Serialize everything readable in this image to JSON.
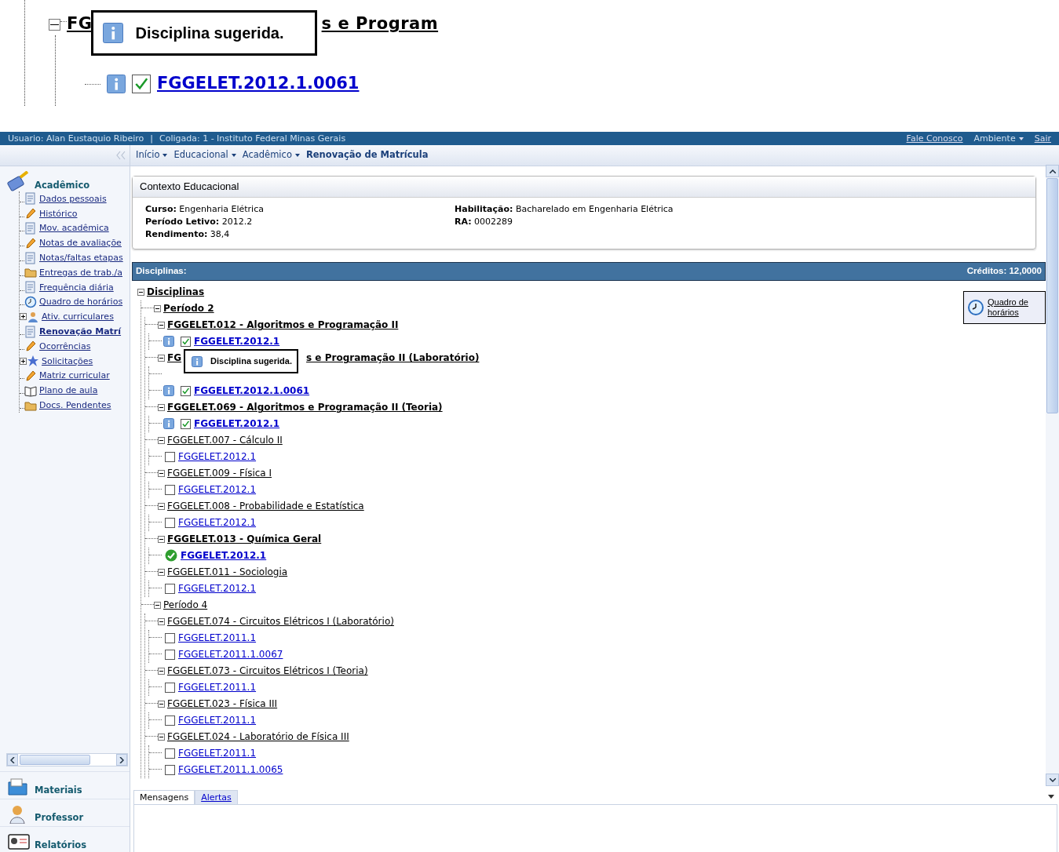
{
  "magnified_view": {
    "course_fragments": [
      "FG",
      "s e Program"
    ],
    "tooltip": "Disciplina sugerida.",
    "class": {
      "info": true,
      "checked": true,
      "code": "FGGELET.2012.1.0061"
    }
  },
  "top_bar": {
    "user": "Usuario: Alan Eustaquio Ribeiro",
    "separator": "|",
    "coligada": "Coligada: 1 - Instituto Federal Minas Gerais",
    "links": [
      {
        "label": "Fale Conosco",
        "kind": "link"
      },
      {
        "label": "Ambiente",
        "kind": "dropdown"
      },
      {
        "label": "Sair",
        "kind": "link"
      }
    ]
  },
  "breadcrumb": [
    {
      "label": "Início",
      "kind": "dropdown"
    },
    {
      "label": "Educacional",
      "kind": "dropdown"
    },
    {
      "label": "Acadêmico",
      "kind": "dropdown"
    },
    {
      "label": "Renovação de Matrícula",
      "kind": "current"
    }
  ],
  "sidebar": {
    "section": "Acadêmico",
    "items": [
      {
        "label": "Dados pessoais",
        "kind": "link",
        "selected": false
      },
      {
        "label": "Histórico",
        "kind": "link",
        "selected": false
      },
      {
        "label": "Mov. acadêmica",
        "kind": "link",
        "selected": false
      },
      {
        "label": "Notas de avaliaçõe",
        "kind": "link",
        "selected": false
      },
      {
        "label": "Notas/faltas etapas",
        "kind": "link",
        "selected": false
      },
      {
        "label": "Entregas de trab./a",
        "kind": "link",
        "selected": false
      },
      {
        "label": "Frequência diária",
        "kind": "link",
        "selected": false
      },
      {
        "label": "Quadro de horários",
        "kind": "link",
        "selected": false
      },
      {
        "label": "Ativ. curriculares",
        "kind": "group",
        "selected": false
      },
      {
        "label": "Renovação Matrí",
        "kind": "link",
        "selected": true
      },
      {
        "label": "Ocorrências",
        "kind": "link",
        "selected": false
      },
      {
        "label": "Solicitações",
        "kind": "group",
        "selected": false
      },
      {
        "label": "Matriz curricular",
        "kind": "link",
        "selected": false
      },
      {
        "label": "Plano de aula",
        "kind": "link",
        "selected": false
      },
      {
        "label": "Docs. Pendentes",
        "kind": "link",
        "selected": false
      }
    ],
    "sections": [
      "Materiais",
      "Professor",
      "Relatórios"
    ]
  },
  "context": {
    "title": "Contexto Educacional",
    "left": [
      {
        "label": "Curso:",
        "value": "Engenharia Elétrica"
      },
      {
        "label": "Período Letivo:",
        "value": "2012.2"
      },
      {
        "label": "Rendimento:",
        "value": "38,4"
      }
    ],
    "right": [
      {
        "label": "Habilitação:",
        "value": "Bacharelado em Engenharia Elétrica"
      },
      {
        "label": "RA:",
        "value": "0002289"
      }
    ]
  },
  "disciplinas_header": {
    "title": "Disciplinas:",
    "credits": "Créditos: 12,0000"
  },
  "schedule_button": "Quadro de horários",
  "tree": {
    "kind": "root",
    "label": "Disciplinas",
    "expanded": true,
    "children": [
      {
        "kind": "period",
        "label": "Período 2",
        "enrolled": true,
        "expanded": true,
        "children": [
          {
            "kind": "course",
            "label": "FGGELET.012 - Algoritmos e Programação II",
            "enrolled": true,
            "expanded": true,
            "children": [
              {
                "kind": "class",
                "info": true,
                "checked": true,
                "code": "FGGELET.2012.1"
              }
            ]
          },
          {
            "kind": "course",
            "label_parts": [
              "FG",
              "s e Programação II (Laboratório)"
            ],
            "tooltip": "Disciplina sugerida.",
            "enrolled": true,
            "expanded": true,
            "children": [
              {
                "kind": "covered"
              },
              {
                "kind": "class",
                "info": true,
                "checked": true,
                "code": "FGGELET.2012.1.0061"
              }
            ]
          },
          {
            "kind": "course",
            "label": "FGGELET.069 - Algoritmos e Programação II (Teoria)",
            "enrolled": true,
            "expanded": true,
            "children": [
              {
                "kind": "class",
                "info": true,
                "checked": true,
                "code": "FGGELET.2012.1"
              }
            ]
          },
          {
            "kind": "course",
            "label": "FGGELET.007 - Cálculo II",
            "enrolled": false,
            "expanded": true,
            "children": [
              {
                "kind": "class",
                "info": false,
                "checked": false,
                "code": "FGGELET.2012.1"
              }
            ]
          },
          {
            "kind": "course",
            "label": "FGGELET.009 - Física I",
            "enrolled": false,
            "expanded": true,
            "children": [
              {
                "kind": "class",
                "info": false,
                "checked": false,
                "code": "FGGELET.2012.1"
              }
            ]
          },
          {
            "kind": "course",
            "label": "FGGELET.008 - Probabilidade e Estatística",
            "enrolled": false,
            "expanded": true,
            "children": [
              {
                "kind": "class",
                "info": false,
                "checked": false,
                "code": "FGGELET.2012.1"
              }
            ]
          },
          {
            "kind": "course",
            "label": "FGGELET.013 - Química Geral",
            "enrolled": true,
            "expanded": true,
            "children": [
              {
                "kind": "approved",
                "info": false,
                "code": "FGGELET.2012.1"
              }
            ]
          },
          {
            "kind": "course",
            "label": "FGGELET.011 - Sociologia",
            "enrolled": false,
            "expanded": true,
            "children": [
              {
                "kind": "class",
                "info": false,
                "checked": false,
                "code": "FGGELET.2012.1"
              }
            ]
          }
        ]
      },
      {
        "kind": "period",
        "label": "Período 4",
        "enrolled": false,
        "expanded": true,
        "children": [
          {
            "kind": "course",
            "label": "FGGELET.074 - Circuitos Elétricos I (Laboratório)",
            "enrolled": false,
            "expanded": true,
            "children": [
              {
                "kind": "class",
                "info": false,
                "checked": false,
                "code": "FGGELET.2011.1"
              },
              {
                "kind": "class",
                "info": false,
                "checked": false,
                "code": "FGGELET.2011.1.0067"
              }
            ]
          },
          {
            "kind": "course",
            "label": "FGGELET.073 - Circuitos Elétricos I (Teoria)",
            "enrolled": false,
            "expanded": true,
            "children": [
              {
                "kind": "class",
                "info": false,
                "checked": false,
                "code": "FGGELET.2011.1"
              }
            ]
          },
          {
            "kind": "course",
            "label": "FGGELET.023 - Física III",
            "enrolled": false,
            "expanded": true,
            "children": [
              {
                "kind": "class",
                "info": false,
                "checked": false,
                "code": "FGGELET.2011.1"
              }
            ]
          },
          {
            "kind": "course",
            "label": "FGGELET.024 - Laboratório de Física III",
            "enrolled": false,
            "expanded": true,
            "children": [
              {
                "kind": "class",
                "info": false,
                "checked": false,
                "code": "FGGELET.2011.1"
              },
              {
                "kind": "class",
                "info": false,
                "checked": false,
                "code": "FGGELET.2011.1.0065"
              }
            ]
          }
        ]
      }
    ]
  },
  "bottom_tabs": [
    {
      "label": "Mensagens",
      "selected": true
    },
    {
      "label": "Alertas",
      "selected": false
    }
  ]
}
